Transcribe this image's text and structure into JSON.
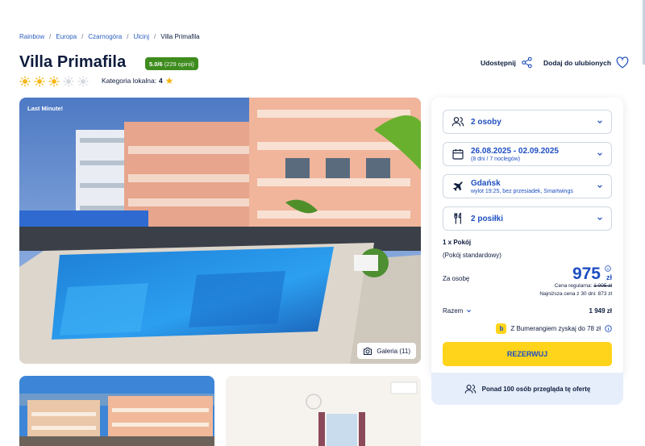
{
  "breadcrumb": [
    "Rainbow",
    "Europa",
    "Czarnogóra",
    "Ulcinj",
    "Villa Primafila"
  ],
  "hotel": {
    "name": "Villa Primafila",
    "rating": "5.0/6",
    "reviews": "(229 opinii)",
    "suns_filled": 3,
    "suns_total": 5,
    "category_label": "Kategoria lokalna:",
    "category_value": "4"
  },
  "actions": {
    "share": "Udostępnij",
    "favorite": "Dodaj do ulubionych"
  },
  "gallery": {
    "badge": "Last Minute!",
    "button": "Galeria (11)"
  },
  "booking": {
    "people": "2 osoby",
    "dates": "26.08.2025 - 02.09.2025",
    "dates_sub": "(8 dni / 7 noclegów)",
    "flight_from": "Gdańsk",
    "flight_sub": "wylot 19:25, bez przesiadek, Smartwings",
    "meals": "2 posiłki",
    "room": "1 x Pokój",
    "room_type": "(Pokój standardowy)",
    "per_person_label": "Za osobę",
    "price": "975",
    "currency": "zł",
    "regular_label": "Cena regularna:",
    "regular_price": "1 005 zł",
    "lowest_label": "Najniższa cena z 30 dni: 873 zł",
    "total_label": "Razem",
    "total_value": "1 949 zł",
    "bumerang": "Z Bumerangiem zyskaj do 78 zł",
    "book_button": "REZERWUJ",
    "viewers": "Ponad 100 osób przegląda tę ofertę"
  },
  "colors": {
    "brand_blue": "#1d4ec0",
    "accent_yellow": "#ffd41a",
    "rating_green": "#3e8c1e",
    "sun_yellow": "#f7b614"
  }
}
